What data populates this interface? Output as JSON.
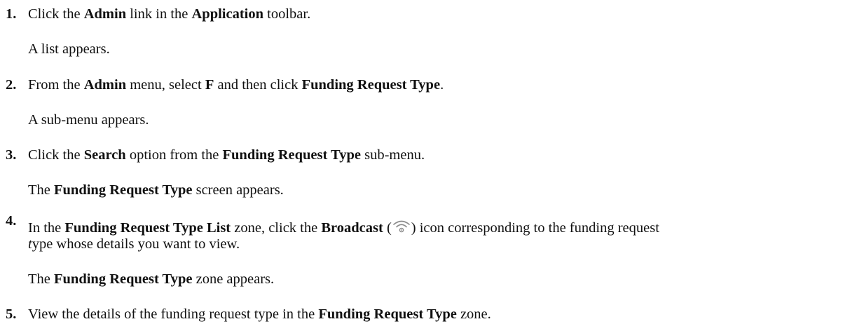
{
  "steps": [
    {
      "number": "1.",
      "instruction": {
        "a": "Click the ",
        "b": "Admin",
        "c": " link in the ",
        "d": "Application",
        "e": " toolbar."
      },
      "result": {
        "a": "A list appears."
      }
    },
    {
      "number": "2.",
      "instruction": {
        "a": "From the ",
        "b": "Admin",
        "c": " menu, select ",
        "d": "F",
        "e": " and then click ",
        "f": "Funding Request Type",
        "g": "."
      },
      "result": {
        "a": "A sub-menu appears."
      }
    },
    {
      "number": "3.",
      "instruction": {
        "a": "Click the ",
        "b": "Search",
        "c": " option from the ",
        "d": "Funding Request Type",
        "e": " sub-menu."
      },
      "result": {
        "a": "The ",
        "b": "Funding Request Type",
        "c": " screen appears."
      }
    },
    {
      "number": "4.",
      "instruction": {
        "a": "In the ",
        "b": "Funding Request Type List",
        "c": " zone, click the ",
        "d": "Broadcast",
        "e": " (",
        "icon": "broadcast-icon",
        "f": ") icon corresponding to the funding request",
        "g": "t",
        "h": "ype whose details you want to view."
      },
      "result": {
        "a": "The ",
        "b": "Funding Request Type",
        "c": " zone appears."
      }
    },
    {
      "number": "5.",
      "instruction": {
        "a": "View the details of the funding request type in the ",
        "b": "Funding Request Type",
        "c": " zone."
      }
    }
  ]
}
